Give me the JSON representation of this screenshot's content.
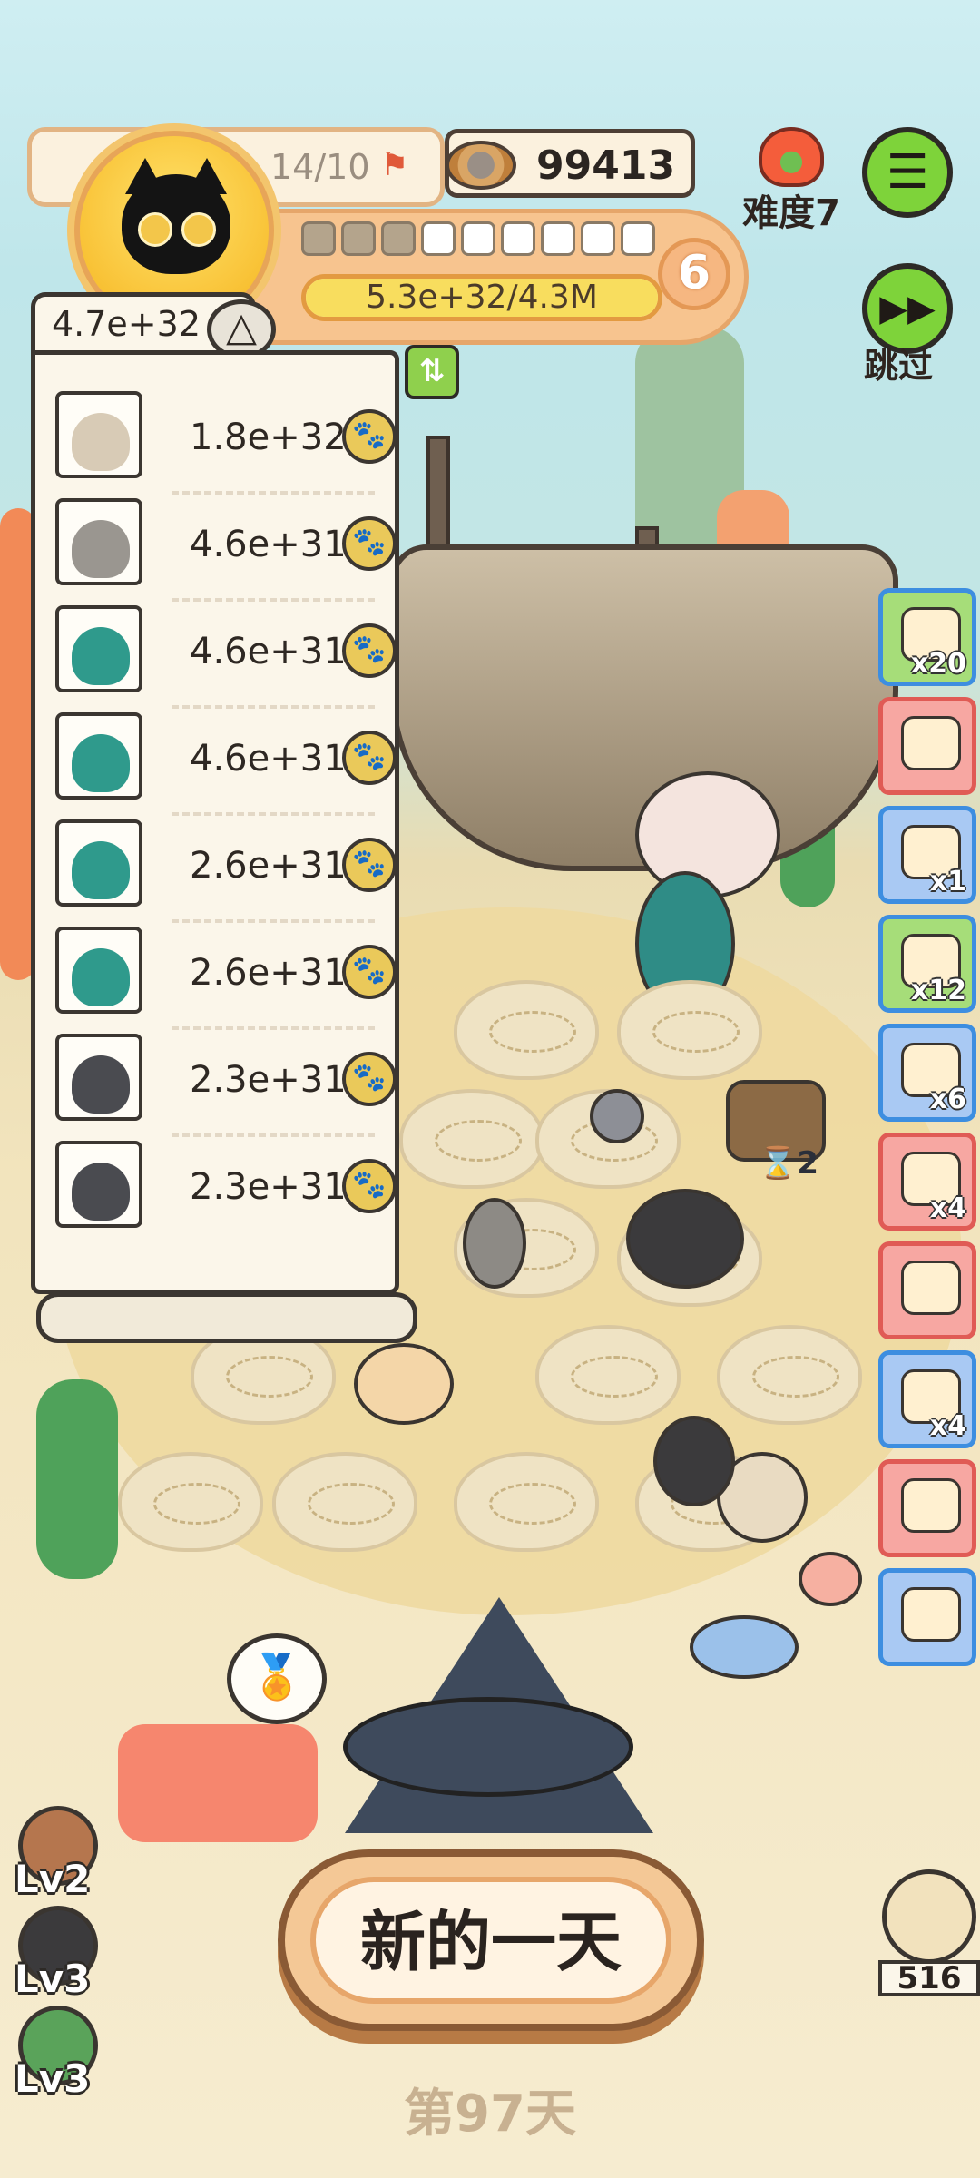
{
  "player": {
    "level_text": "14/10",
    "progress_text": "5.3e+32/4.3M",
    "progress_fill": 1.0,
    "segments_done": 3,
    "segments_total": 9,
    "level_badge": "6"
  },
  "currency": {
    "value": "99413"
  },
  "difficulty": {
    "label": "难度7"
  },
  "skip": {
    "label": "跳过"
  },
  "ranking": {
    "total": "4.7e+32",
    "rows": [
      {
        "animal": "hedgehog",
        "value": "1.8e+32"
      },
      {
        "animal": "jerboa",
        "value": "4.6e+31"
      },
      {
        "animal": "peacock",
        "value": "4.6e+31"
      },
      {
        "animal": "peacock",
        "value": "4.6e+31"
      },
      {
        "animal": "peacock",
        "value": "2.6e+31"
      },
      {
        "animal": "peacock",
        "value": "2.6e+31"
      },
      {
        "animal": "mole",
        "value": "2.3e+31"
      },
      {
        "animal": "mole",
        "value": "2.3e+31"
      }
    ]
  },
  "side_items": [
    {
      "name": "tent-icon",
      "count": "x20"
    },
    {
      "name": "feather-icon",
      "count": ""
    },
    {
      "name": "shop-icon",
      "count": "x1"
    },
    {
      "name": "worm-icon",
      "count": "x12"
    },
    {
      "name": "glove-icon",
      "count": "x6"
    },
    {
      "name": "scroll-icon",
      "count": "x4"
    },
    {
      "name": "rope-icon",
      "count": ""
    },
    {
      "name": "sack-icon",
      "count": "x4"
    },
    {
      "name": "heart-letter-icon",
      "count": ""
    },
    {
      "name": "hut-icon",
      "count": ""
    }
  ],
  "pets": [
    {
      "label": "Lv2"
    },
    {
      "label": "Lv3"
    },
    {
      "label": "Lv3"
    }
  ],
  "new_day_button": "新的一天",
  "day_label": "第97天",
  "corner_pet": {
    "count": "516"
  },
  "chest_timer": "2",
  "colors": {
    "accent_green": "#7ed33a",
    "panel_orange": "#f7c48f",
    "coin_yellow": "#eac95a"
  }
}
